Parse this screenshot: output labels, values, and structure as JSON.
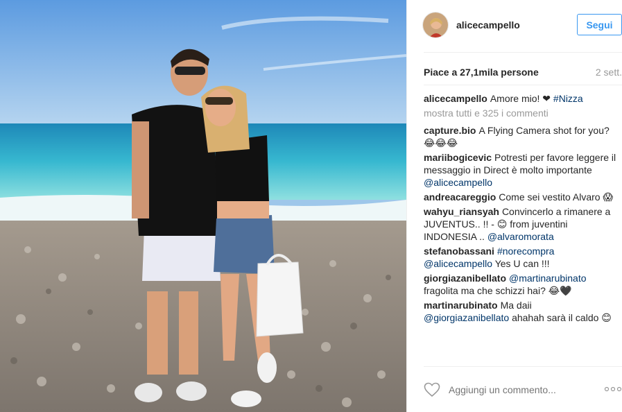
{
  "post": {
    "username": "alicecampello",
    "follow_label": "Segui",
    "likes": "Piace a 27,1mila persone",
    "time": "2 sett.",
    "caption": {
      "user": "alicecampello",
      "text": "Amore mio! ❤",
      "tag": "#Nizza"
    },
    "show_more": "mostra tutti e 325 i commenti",
    "comments": [
      {
        "user": "capture.bio",
        "text": "A Flying Camera shot for you? 😂😂😂"
      },
      {
        "user": "mariibogicevic",
        "text": "Potresti per favore leggere il messaggio in Direct è molto importante",
        "mention": "@alicecampello"
      },
      {
        "user": "andreacareggio",
        "text": "Come sei vestito Alvaro 😱"
      },
      {
        "user": "wahyu_riansyah",
        "text": "Convincerlo a rimanere a JUVENTUS.. !! - 😊 from juventini INDONESIA ..",
        "mention": "@alvaromorata"
      },
      {
        "user": "stefanobassani",
        "text": "",
        "mention": "#norecompra @alicecampello",
        "after": "Yes U can !!!"
      },
      {
        "user": "giorgiazanibellato",
        "text": "fragolita ma che schizzi hai? 😂🖤",
        "mention_first": "@martinarubinato"
      },
      {
        "user": "martinarubinato",
        "text": "Ma daii",
        "mention_mid": "@giorgiazanibellato",
        "after": "ahahah sarà il caldo 😊"
      }
    ],
    "add_comment_placeholder": "Aggiungi un commento...",
    "options_icon": "ellipsis-icon"
  },
  "colors": {
    "link": "#003569",
    "follow": "#3897f0",
    "muted": "#999999"
  }
}
